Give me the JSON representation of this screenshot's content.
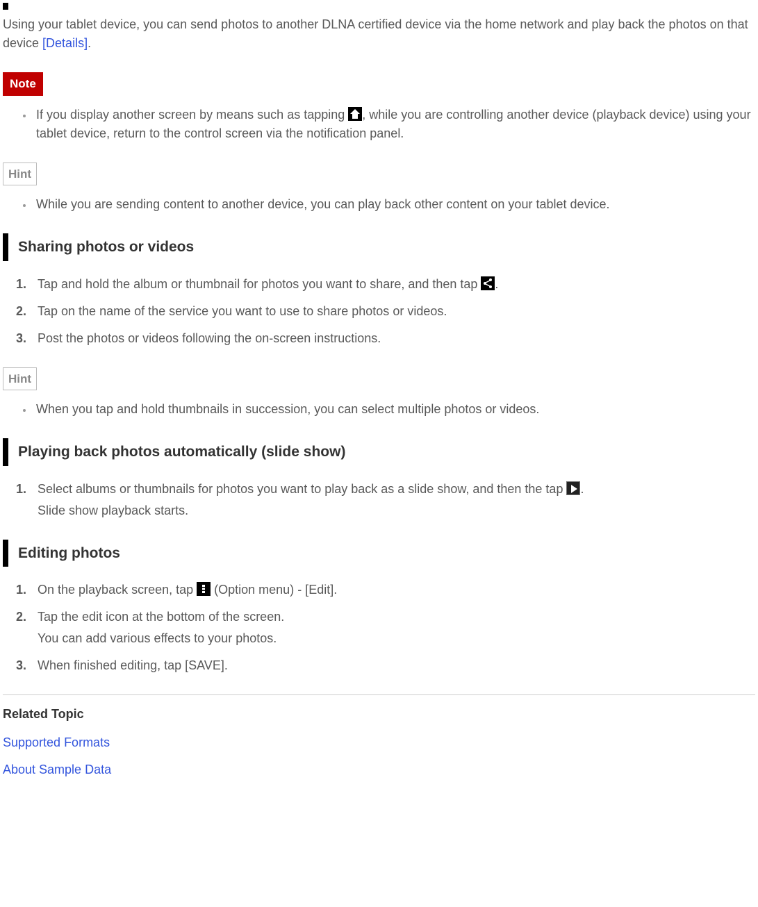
{
  "intro": {
    "text_before": "Using your tablet device, you can send photos to another DLNA certified device via the home network and play back the photos on that device ",
    "link_label": "[Details]",
    "text_after": "."
  },
  "note": {
    "badge": "Note",
    "items": [
      {
        "before": "If you display another screen by means such as tapping ",
        "icon": "home-icon",
        "after": ", while you are controlling another device (playback device) using your tablet device, return to the control screen via the notification panel."
      }
    ]
  },
  "hint1": {
    "badge": "Hint",
    "items": [
      "While you are sending content to another device, you can play back other content on your tablet device."
    ]
  },
  "sharing": {
    "heading": "Sharing photos or videos",
    "steps": [
      {
        "before": "Tap and hold the album or thumbnail for photos you want to share, and then tap ",
        "icon": "share-icon",
        "after": "."
      },
      {
        "text": "Tap on the name of the service you want to use to share photos or videos."
      },
      {
        "text": "Post the photos or videos following the on-screen instructions."
      }
    ]
  },
  "hint2": {
    "badge": "Hint",
    "items": [
      "When you tap and hold thumbnails in succession, you can select multiple photos or videos."
    ]
  },
  "slideshow": {
    "heading": "Playing back photos automatically (slide show)",
    "steps": [
      {
        "before": "Select albums or thumbnails for photos you want to play back as a slide show, and then the tap ",
        "icon": "play-icon",
        "after": ".",
        "sub": "Slide show playback starts."
      }
    ]
  },
  "editing": {
    "heading": "Editing photos",
    "steps": [
      {
        "before": "On the playback screen, tap ",
        "icon": "options-icon",
        "after": " (Option menu) - [Edit]."
      },
      {
        "text": "Tap the edit icon at the bottom of the screen.",
        "sub": "You can add various effects to your photos."
      },
      {
        "text": "When finished editing, tap [SAVE]."
      }
    ]
  },
  "related": {
    "heading": "Related Topic",
    "links": [
      "Supported Formats",
      "About Sample Data"
    ]
  }
}
